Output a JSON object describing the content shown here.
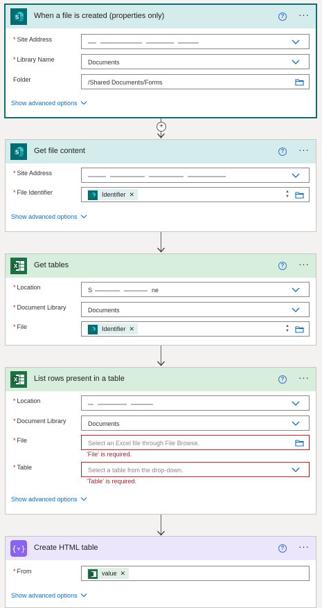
{
  "colors": {
    "sharepoint": "#036c70",
    "excel": "#1e7145",
    "data_operation": "#8a63f0",
    "error": "#a4262c",
    "link": "#0f6cbd"
  },
  "steps": [
    {
      "title": "When a file is created (properties only)",
      "icon": "sharepoint-icon",
      "fields": [
        {
          "label": "Site Address",
          "required": true,
          "value": "",
          "redacted": true,
          "control": "dropdown"
        },
        {
          "label": "Library Name",
          "required": true,
          "value": "Documents",
          "control": "dropdown"
        },
        {
          "label": "Folder",
          "required": false,
          "value": "/Shared Documents/Forms",
          "control": "folder-picker"
        }
      ],
      "advanced_link": "Show advanced options"
    },
    {
      "title": "Get file content",
      "icon": "sharepoint-icon",
      "fields": [
        {
          "label": "Site Address",
          "required": true,
          "value": "",
          "redacted": true,
          "control": "dropdown"
        },
        {
          "label": "File Identifier",
          "required": true,
          "token": "Identifier",
          "control": "folder-picker"
        }
      ],
      "advanced_link": "Show advanced options"
    },
    {
      "title": "Get tables",
      "icon": "excel-icon",
      "fields": [
        {
          "label": "Location",
          "required": true,
          "value": "S",
          "value_suffix": "ne",
          "redacted": true,
          "control": "dropdown"
        },
        {
          "label": "Document Library",
          "required": true,
          "value": "Documents",
          "control": "dropdown"
        },
        {
          "label": "File",
          "required": true,
          "token": "Identifier",
          "control": "folder-picker"
        }
      ]
    },
    {
      "title": "List rows present in a table",
      "icon": "excel-icon",
      "fields": [
        {
          "label": "Location",
          "required": true,
          "value": "",
          "redacted": true,
          "control": "dropdown"
        },
        {
          "label": "Document Library",
          "required": true,
          "value": "Documents",
          "control": "dropdown"
        },
        {
          "label": "File",
          "required": true,
          "placeholder": "Select an Excel file through File Browse.",
          "error": "'File' is required.",
          "control": "folder-picker"
        },
        {
          "label": "Table",
          "required": true,
          "placeholder": "Select a table from the drop-down.",
          "error": "'Table' is required.",
          "control": "dropdown"
        }
      ],
      "advanced_link": "Show advanced options"
    },
    {
      "title": "Create HTML table",
      "icon": "data-operation-icon",
      "fields": [
        {
          "label": "From",
          "required": true,
          "token": "value"
        }
      ],
      "advanced_link": "Show advanced options"
    }
  ]
}
